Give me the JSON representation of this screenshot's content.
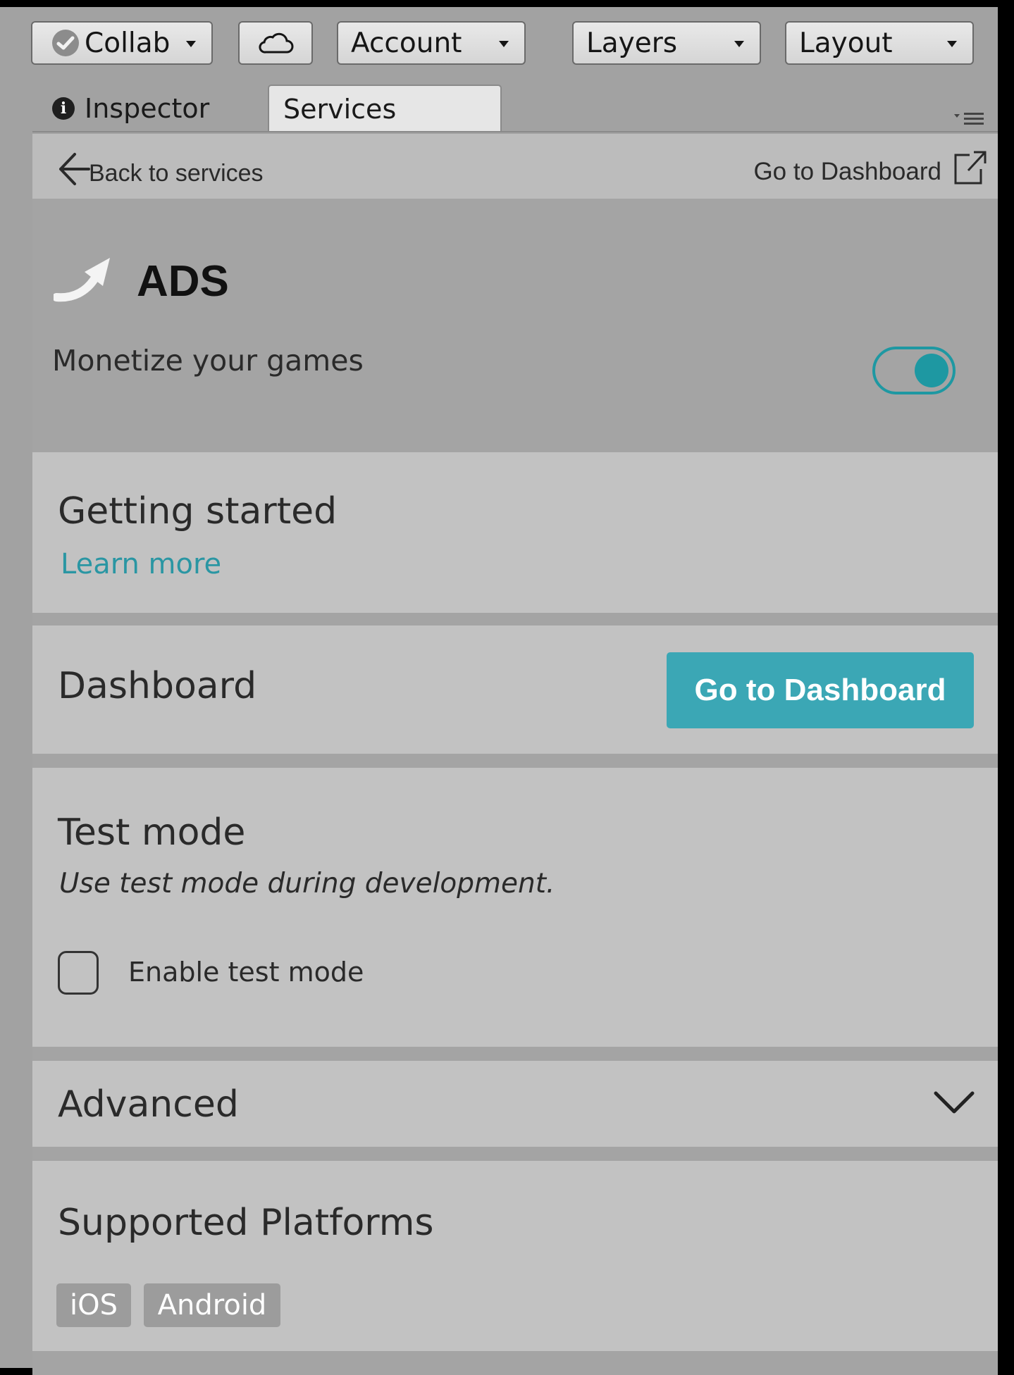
{
  "toolbar": {
    "collab_label": "Collab",
    "account_label": "Account",
    "layers_label": "Layers",
    "layout_label": "Layout"
  },
  "tabs": {
    "inspector": "Inspector",
    "services": "Services"
  },
  "nav": {
    "back_label": "Back to services",
    "dashboard_link": "Go to Dashboard"
  },
  "service": {
    "name": "ADS",
    "description": "Monetize your games",
    "enabled": true
  },
  "getting_started": {
    "title": "Getting started",
    "link": "Learn more"
  },
  "dashboard": {
    "title": "Dashboard",
    "button_label": "Go to Dashboard"
  },
  "test_mode": {
    "title": "Test mode",
    "subtitle": "Use test mode during development.",
    "checkbox_label": "Enable test mode",
    "checked": false
  },
  "advanced": {
    "title": "Advanced"
  },
  "platforms": {
    "title": "Supported Platforms",
    "items": [
      "iOS",
      "Android"
    ]
  },
  "colors": {
    "accent": "#1e98a2",
    "button": "#3ba7b5",
    "link": "#2a96a3"
  }
}
